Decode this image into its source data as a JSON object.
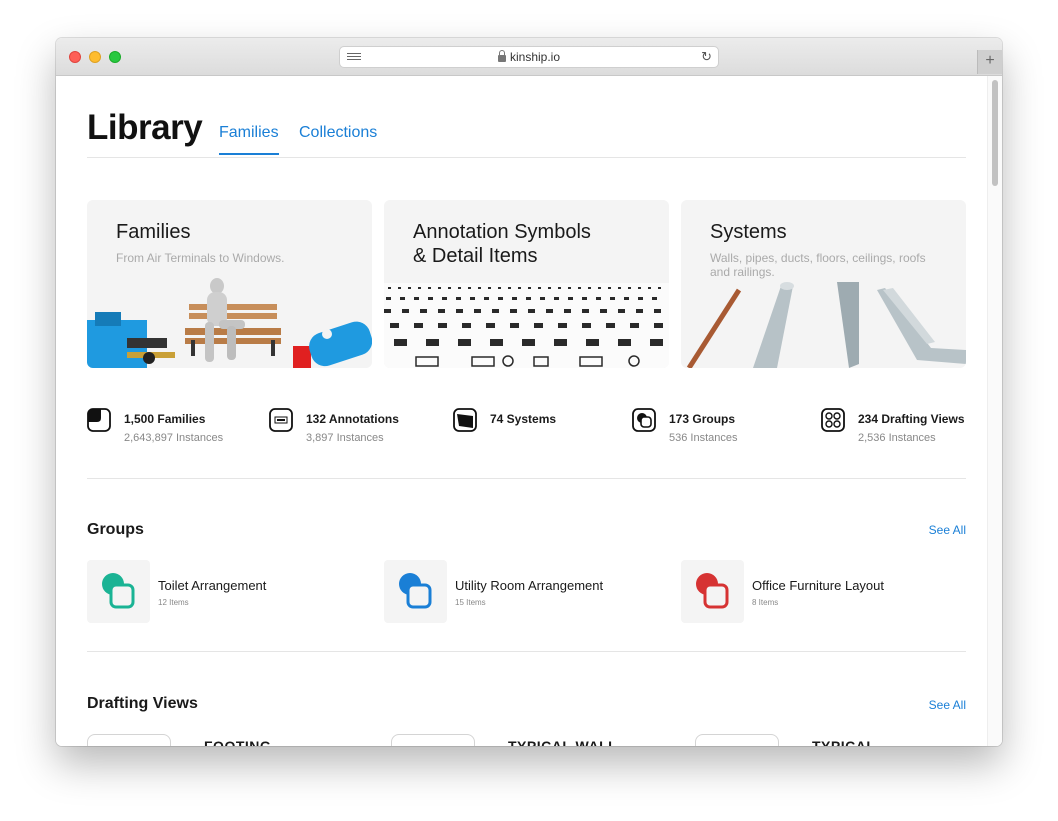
{
  "browser": {
    "url": "kinship.io"
  },
  "header": {
    "title": "Library",
    "tabs": [
      {
        "label": "Families",
        "active": true
      },
      {
        "label": "Collections",
        "active": false
      }
    ]
  },
  "cards": [
    {
      "title": "Families",
      "subtitle": "From Air Terminals to Windows."
    },
    {
      "title_line1": "Annotation Symbols",
      "title_line2": "& Detail Items",
      "subtitle": ""
    },
    {
      "title": "Systems",
      "subtitle": "Walls, pipes, ducts, floors, ceilings, roofs and railings."
    }
  ],
  "stats": [
    {
      "icon": "families-icon",
      "title": "1,500 Families",
      "subtitle": "2,643,897 Instances"
    },
    {
      "icon": "annotations-icon",
      "title": "132 Annotations",
      "subtitle": "3,897 Instances"
    },
    {
      "icon": "systems-icon",
      "title": "74 Systems",
      "subtitle": ""
    },
    {
      "icon": "groups-icon",
      "title": "173 Groups",
      "subtitle": "536 Instances"
    },
    {
      "icon": "drafting-views-icon",
      "title": "234 Drafting Views",
      "subtitle": "2,536 Instances"
    }
  ],
  "groups": {
    "title": "Groups",
    "see_all": "See All",
    "items": [
      {
        "title": "Toilet Arrangement",
        "subtitle": "12 Items",
        "color": "#1ab394"
      },
      {
        "title": "Utility Room Arrangement",
        "subtitle": "15 Items",
        "color": "#1a7fd6"
      },
      {
        "title": "Office Furniture Layout",
        "subtitle": "8 Items",
        "color": "#d63333"
      }
    ]
  },
  "drafting_views": {
    "title": "Drafting Views",
    "see_all": "See All",
    "items": [
      {
        "title": "FOOTING"
      },
      {
        "title": "TYPICAL WALL"
      },
      {
        "title": "TYPICAL"
      }
    ]
  },
  "colors": {
    "accent": "#1a7fd6",
    "text": "#1a1a1a",
    "muted": "#888888"
  }
}
